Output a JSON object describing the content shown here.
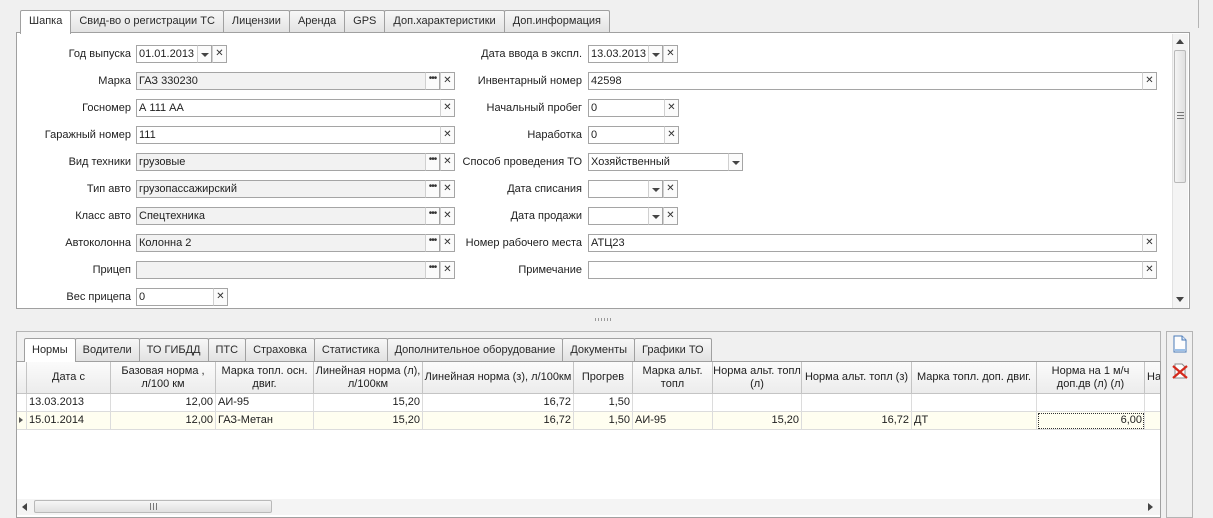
{
  "top_tabs": [
    "Шапка",
    "Свид-во о регистрации ТС",
    "Лицензии",
    "Аренда",
    "GPS",
    "Доп.характеристики",
    "Доп.информация"
  ],
  "left_fields": [
    {
      "label": "Год выпуска",
      "value": "01.01.2013"
    },
    {
      "label": "Марка",
      "value": "ГАЗ 330230"
    },
    {
      "label": "Госномер",
      "value": "А 111 АА"
    },
    {
      "label": "Гаражный номер",
      "value": "111"
    },
    {
      "label": "Вид техники",
      "value": "грузовые"
    },
    {
      "label": "Тип авто",
      "value": "грузопассажирский"
    },
    {
      "label": "Класс авто",
      "value": "Спецтехника"
    },
    {
      "label": "Автоколонна",
      "value": "Колонна 2"
    },
    {
      "label": "Прицеп",
      "value": ""
    },
    {
      "label": "Вес прицепа",
      "value": "0"
    }
  ],
  "right_fields": [
    {
      "label": "Дата ввода в экспл.",
      "value": "13.03.2013"
    },
    {
      "label": "Инвентарный номер",
      "value": "42598"
    },
    {
      "label": "Начальный пробег",
      "value": "0"
    },
    {
      "label": "Наработка",
      "value": "0"
    },
    {
      "label": "Способ проведения ТО",
      "value": "Хозяйственный"
    },
    {
      "label": "Дата списания",
      "value": ""
    },
    {
      "label": "Дата продажи",
      "value": ""
    },
    {
      "label": "Номер рабочего места",
      "value": "АТЦ23"
    },
    {
      "label": "Примечание",
      "value": ""
    }
  ],
  "bottom_tabs": [
    "Нормы",
    "Водители",
    "ТО ГИБДД",
    "ПТС",
    "Страховка",
    "Статистика",
    "Дополнительное оборудование",
    "Документы",
    "Графики ТО"
  ],
  "grid": {
    "columns": [
      "Дата с",
      "Базовая норма , л/100 км",
      "Марка топл. осн. двиг.",
      "Линейная норма (л), л/100км",
      "Линейная норма (з), л/100км",
      "Прогрев",
      "Марка альт. топл",
      "Норма альт. топл (л)",
      "Норма альт. топл (з)",
      "Марка топл. доп. двиг.",
      "Норма на 1 м/ч доп.дв (л) (л)",
      "На"
    ],
    "rows": [
      [
        "13.03.2013",
        "12,00",
        "АИ-95",
        "15,20",
        "16,72",
        "1,50",
        "",
        "",
        "",
        "",
        "",
        ""
      ],
      [
        "15.01.2014",
        "12,00",
        "ГАЗ-Метан",
        "15,20",
        "16,72",
        "1,50",
        "АИ-95",
        "15,20",
        "16,72",
        "ДТ",
        "6,00",
        ""
      ]
    ]
  },
  "icons": {
    "new_document": "new-document-icon",
    "delete": "delete-icon"
  },
  "colors": {
    "background": "#f0f0f0",
    "panel": "#ffffff",
    "border": "#a0a0a0",
    "readonly_field": "#f2f2f2",
    "selected_row": "#fffef0"
  }
}
